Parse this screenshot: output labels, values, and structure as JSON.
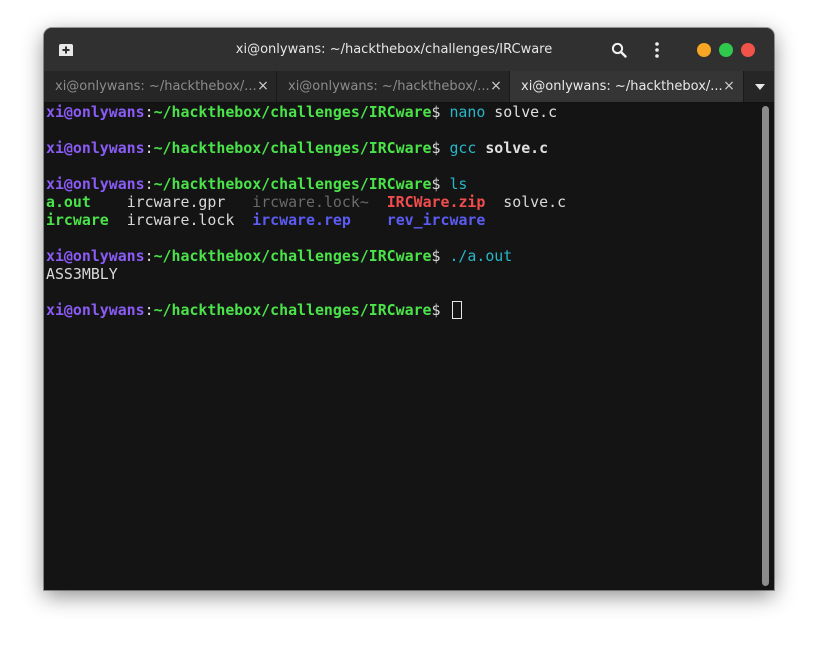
{
  "window": {
    "title": "xi@onlywans: ~/hackthebox/challenges/IRCware",
    "controls": [
      "minimize",
      "maximize",
      "close"
    ],
    "colors": {
      "minimize": "#f6a623",
      "maximize": "#2fc94d",
      "close": "#f0534a"
    }
  },
  "titlebar": {
    "new_tab_icon": "new-tab-icon",
    "search_icon": "search-icon",
    "menu_icon": "kebab-menu-icon"
  },
  "tabs": [
    {
      "label": "xi@onlywans: ~/hackthebox/...",
      "close": "×",
      "active": false
    },
    {
      "label": "xi@onlywans: ~/hackthebox/...",
      "close": "×",
      "active": false
    },
    {
      "label": "xi@onlywans: ~/hackthebox/...",
      "close": "×",
      "active": true
    }
  ],
  "prompt": {
    "user_host": "xi@onlywans",
    "sep": ":",
    "path": "~/hackthebox/challenges/IRCware",
    "sign": "$ "
  },
  "session": {
    "cmd1": {
      "command": "nano",
      "arg": " solve.c"
    },
    "cmd2": {
      "command": "gcc",
      "arg": "solve.c"
    },
    "cmd3": {
      "command": "ls"
    },
    "ls_row1": [
      "a.out",
      "ircware.gpr",
      "ircware.lock~",
      "IRCWare.zip",
      "solve.c"
    ],
    "ls_row2": [
      "ircware",
      "ircware.lock",
      "ircware.rep",
      "rev_ircware"
    ],
    "cmd4": {
      "command": "./a.out"
    },
    "output": "ASS3MBLY"
  }
}
